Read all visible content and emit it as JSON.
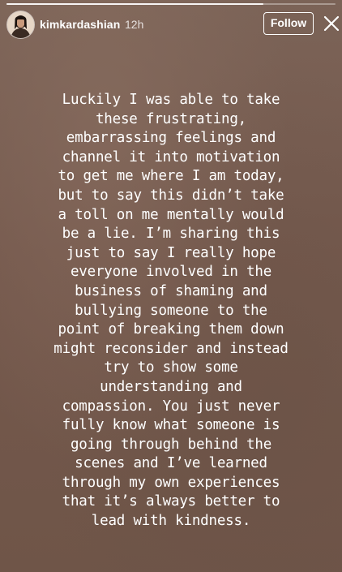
{
  "story": {
    "progress": 0.78,
    "background_color": "#775d51"
  },
  "header": {
    "username": "kimkardashian",
    "timestamp": "12h",
    "follow_label": "Follow",
    "avatar_icon": "profile-avatar",
    "close_icon": "close-x"
  },
  "body": {
    "text": "Luckily I was able to take\nthese frustrating,\nembarrassing feelings and\nchannel it into motivation\nto get me where I am today,\nbut to say this didn’t take\na toll on me mentally would\nbe a lie. I’m sharing this\njust to say I really hope\neveryone involved in the\nbusiness of shaming and\nbullying someone to the\npoint of breaking them down\nmight reconsider and instead\ntry to show some\nunderstanding and\ncompassion. You just never\nfully know what someone is\ngoing through behind the\nscenes and I’ve learned\nthrough my own experiences\nthat it’s always better to\nlead with kindness."
  }
}
